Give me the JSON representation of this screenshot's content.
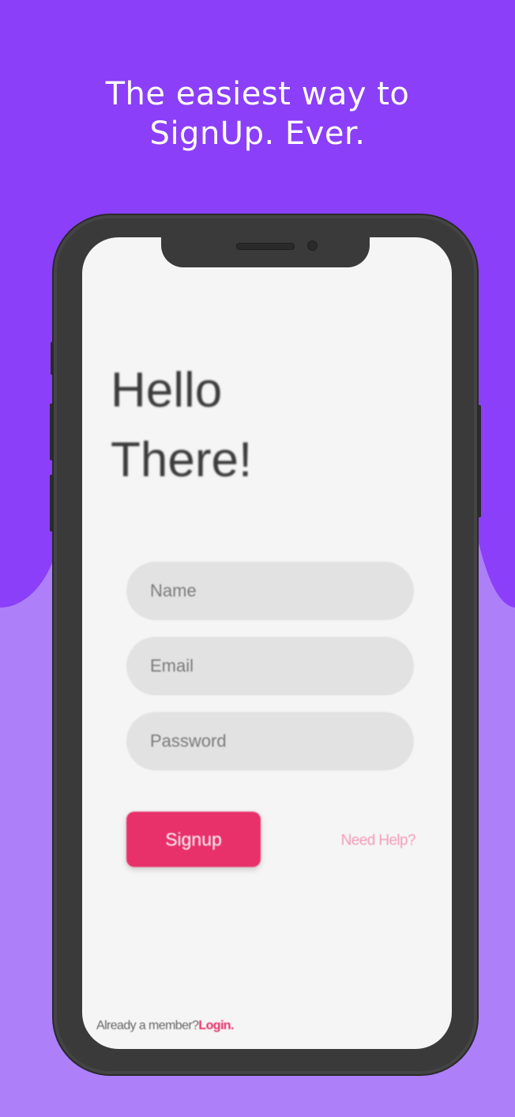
{
  "headline": {
    "line1": "The easiest way to",
    "line2": "SignUp. Ever."
  },
  "screen": {
    "greeting_line1": "Hello",
    "greeting_line2": "There!",
    "form": {
      "name_placeholder": "Name",
      "email_placeholder": "Email",
      "password_placeholder": "Password"
    },
    "signup_label": "Signup",
    "help_label": "Need Help?",
    "footer": {
      "prompt": "Already a member?",
      "login_label": "Login."
    }
  },
  "colors": {
    "background_top": "#8b3ff8",
    "background_bottom": "#ad7ff9",
    "accent": "#e8306a",
    "field": "#e2e2e2",
    "device": "#3a3a3a"
  },
  "icons": [
    "speaker-grille",
    "front-camera"
  ]
}
